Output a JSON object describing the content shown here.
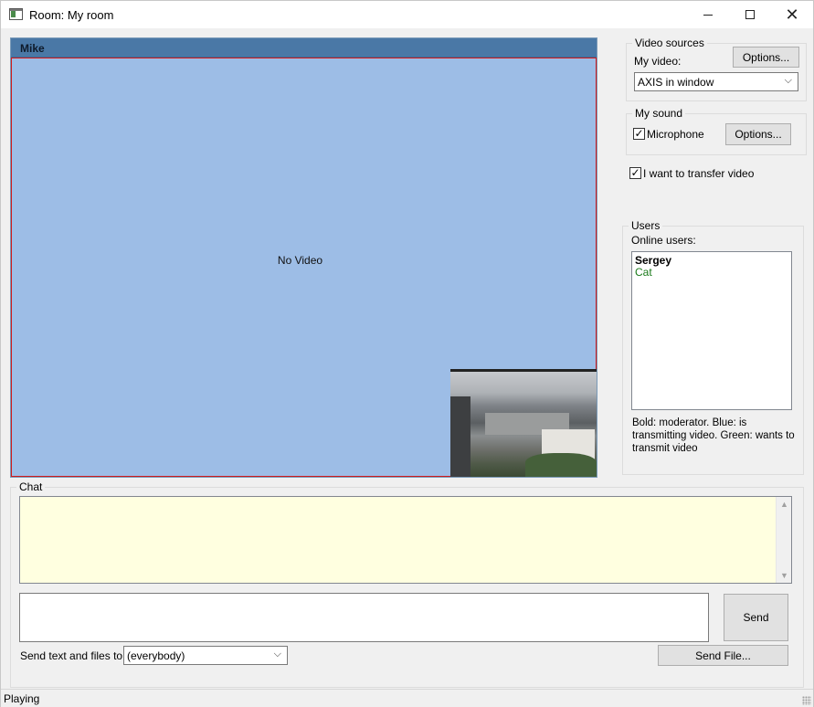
{
  "window": {
    "title": "Room: My room",
    "controls": {
      "minimize": "",
      "maximize": "",
      "close": "✕"
    }
  },
  "video": {
    "user": "Mike",
    "placeholder": "No Video",
    "border_color": "#d21a1a",
    "background": "#9dbde6",
    "header_color": "#4a78a6"
  },
  "video_sources": {
    "title": "Video sources",
    "my_video_label": "My video:",
    "options_button": "Options...",
    "selected_source": "AXIS in window"
  },
  "sound": {
    "title": "My sound",
    "microphone_label": "Microphone",
    "microphone_checked": true,
    "options_button": "Options..."
  },
  "transfer_video": {
    "label": "I want to transfer video",
    "checked": true
  },
  "users": {
    "title": "Users",
    "online_label": "Online users:",
    "list": [
      {
        "name": "Sergey",
        "style": "bold",
        "color": "#000000"
      },
      {
        "name": "Cat",
        "style": "normal",
        "color": "#1a7a1a"
      }
    ],
    "legend": "Bold: moderator. Blue: is transmitting video. Green: wants to transmit video"
  },
  "chat": {
    "title": "Chat",
    "log_background": "#ffffe0",
    "send_button": "Send",
    "send_to_label": "Send text and files to:",
    "send_to_value": "(everybody)",
    "send_file_button": "Send File..."
  },
  "status": {
    "text": "Playing"
  },
  "icons": {
    "dropdown": "chevron-down-icon",
    "check": "checkmark-icon",
    "scroll_up": "arrow-up-icon",
    "scroll_down": "arrow-down-icon"
  }
}
